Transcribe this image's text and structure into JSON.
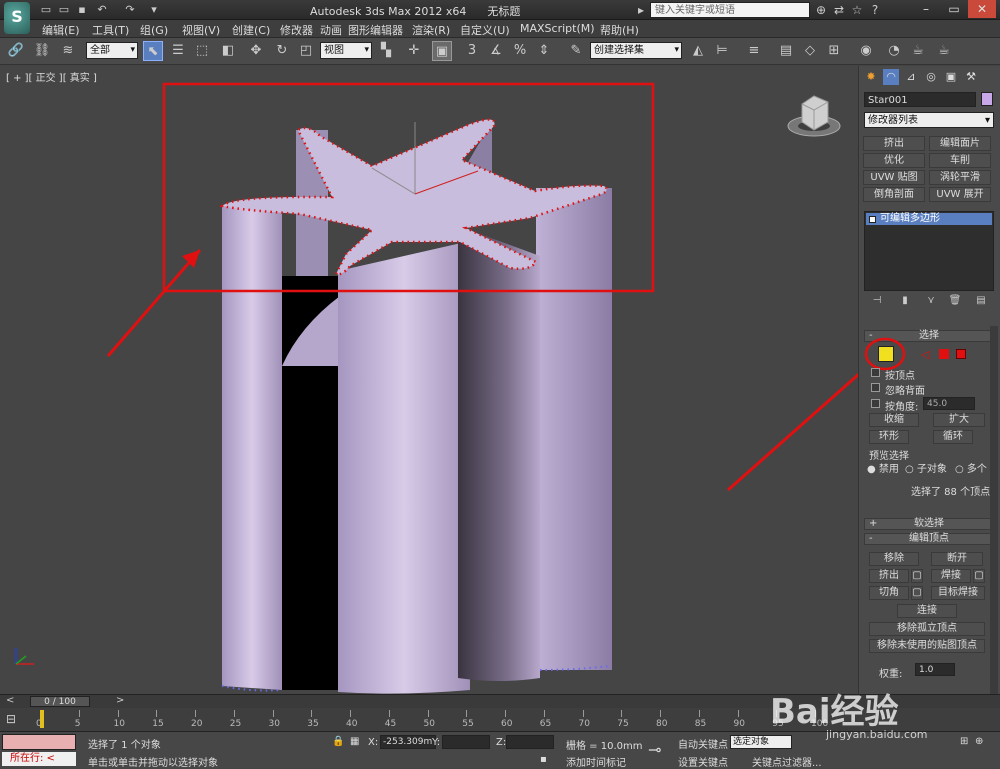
{
  "title_bar": {
    "app_title": "Autodesk 3ds Max  2012 x64",
    "doc_title": "无标题",
    "search_placeholder": "键入关键字或短语",
    "logo": "3ds-max-logo"
  },
  "menu": [
    "编辑(E)",
    "工具(T)",
    "组(G)",
    "视图(V)",
    "创建(C)",
    "修改器",
    "动画",
    "图形编辑器",
    "渲染(R)",
    "自定义(U)",
    "MAXScript(M)",
    "帮助(H)"
  ],
  "toolbar": {
    "filter": "全部",
    "ref_coord": "视图",
    "named_selection": "创建选择集",
    "snap_label": "3",
    "percent_label": "%"
  },
  "viewport": {
    "label": "[ + ][ 正交 ][ 真实 ]",
    "object_color": "#c8bddc",
    "highlight_color": "#e01010"
  },
  "command_panel": {
    "object_name": "Star001",
    "modifier_list": "修改器列表",
    "modifier_buttons": [
      "挤出",
      "编辑面片",
      "优化",
      "车削",
      "UVW 贴图",
      "涡轮平滑",
      "倒角剖面",
      "UVW 展开"
    ],
    "stack_item": "可编辑多边形",
    "selection_rollout": {
      "title": "选择",
      "by_vertex": "按顶点",
      "ignore_backface": "忽略背面",
      "by_angle": "按角度:",
      "angle_value": "45.0",
      "shrink": "收缩",
      "grow": "扩大",
      "ring": "环形",
      "loop": "循环",
      "preview_title": "预览选择",
      "preview_options": [
        "禁用",
        "子对象",
        "多个"
      ],
      "selected_info": "选择了 88 个顶点"
    },
    "soft_selection_title": "软选择",
    "edit_vertices": {
      "title": "编辑顶点",
      "remove": "移除",
      "break": "断开",
      "extrude": "挤出",
      "weld": "焊接",
      "chamfer": "切角",
      "target_weld": "目标焊接",
      "connect": "连接",
      "remove_isolated": "移除孤立顶点",
      "remove_unused_map": "移除未使用的贴图顶点",
      "weight_label": "权重:",
      "weight_value": "1.0"
    }
  },
  "timeline": {
    "frame_display": "0 / 100",
    "ticks": [
      "0",
      "5",
      "10",
      "15",
      "20",
      "25",
      "30",
      "35",
      "40",
      "45",
      "50",
      "55",
      "60",
      "65",
      "70",
      "75",
      "80",
      "85",
      "90",
      "95",
      "100"
    ]
  },
  "status": {
    "running": "所在行:",
    "selected": "选择了 1 个对象",
    "prompt": "单击或单击并拖动以选择对象",
    "x_label": "X:",
    "x_value": "-253.309m",
    "y_label": "Y:",
    "z_label": "Z:",
    "grid": "栅格 = 10.0mm",
    "add_time_tag": "添加时间标记",
    "auto_key": "自动关键点",
    "set_key": "设置关键点",
    "key_mode": "选定对象",
    "key_filters": "关键点过滤器..."
  },
  "watermark": {
    "logo": "Bai经验",
    "url": "jingyan.baidu.com"
  }
}
